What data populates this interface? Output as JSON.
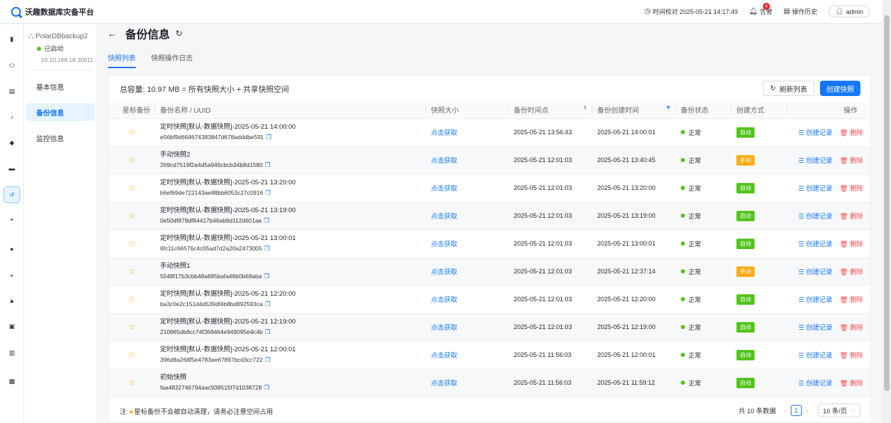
{
  "app": {
    "title": "沃趣数据库灾备平台"
  },
  "topbar": {
    "time_label": "时间校对 2025-05-21 14:17:49",
    "alerts_label": "告警",
    "alerts_count": "4",
    "history_label": "操作历史",
    "user": "admin"
  },
  "instance": {
    "name": "PolarDBbackup2",
    "status": "已启动",
    "address": "10.10.168.18:30011"
  },
  "subnav": [
    "基本信息",
    "备份信息",
    "监控信息"
  ],
  "page": {
    "title": "备份信息"
  },
  "tabs": [
    "快照列表",
    "快照操作日志"
  ],
  "summary": "总容量: 10.97 MB = 所有快照大小 + 共享快照空间",
  "buttons": {
    "refresh": "刷新列表",
    "create": "创建快照"
  },
  "columns": [
    "星标备份",
    "备份名称 / UUID",
    "快照大小",
    "备份时间点",
    "备份创建时间",
    "备份状态",
    "创建方式",
    "操作"
  ],
  "row_actions": {
    "size": "点击获取",
    "record": "创建记录",
    "delete": "删除"
  },
  "rows": [
    {
      "name": "定时快照[默认-数据快照]-2025-05-21 14:00:00",
      "uuid": "e56bf9d664674383847d678adddbe591",
      "time": "2025-05-21 13:56:43",
      "created": "2025-05-21 14:00:01",
      "status": "正常",
      "method": "自动"
    },
    {
      "name": "手动快照2",
      "uuid": "269cd7519f2a4d5a946cbcb34b8d1580",
      "time": "2025-05-21 12:01:03",
      "created": "2025-05-21 13:40:45",
      "status": "正常",
      "method": "手动"
    },
    {
      "name": "定时快照[默认-数据快照]-2025-05-21 13:20:00",
      "uuid": "b6ef69de722143ae88bb6053c27c0916",
      "time": "2025-05-21 12:01:03",
      "created": "2025-05-21 13:20:00",
      "status": "正常",
      "method": "自动"
    },
    {
      "name": "定时快照[默认-数据快照]-2025-05-21 13:19:00",
      "uuid": "0e50df878df84417b46ab9d112d601aa",
      "time": "2025-05-21 12:01:03",
      "created": "2025-05-21 13:19:00",
      "status": "正常",
      "method": "自动"
    },
    {
      "name": "定时快照[默认-数据快照]-2025-05-21 13:00:01",
      "uuid": "6fc11c66576c4c05ad7d2a20a2473005",
      "time": "2025-05-21 12:01:03",
      "created": "2025-05-21 13:00:01",
      "status": "正常",
      "method": "自动"
    },
    {
      "name": "手动快照1",
      "uuid": "5548f17b3cbb48a695bafa46b0b69aba",
      "time": "2025-05-21 12:01:03",
      "created": "2025-05-21 12:37:14",
      "status": "正常",
      "method": "手动"
    },
    {
      "name": "定时快照[默认-数据快照]-2025-05-21 12:20:00",
      "uuid": "ba3c0e2c151d4d539df4b8bd892593ca",
      "time": "2025-05-21 12:01:03",
      "created": "2025-05-21 12:20:00",
      "status": "正常",
      "method": "自动"
    },
    {
      "name": "定时快照[默认-数据快照]-2025-05-21 12:19:00",
      "uuid": "210965db8cc74f368464e949095e4c4b",
      "time": "2025-05-21 12:01:03",
      "created": "2025-05-21 12:19:00",
      "status": "正常",
      "method": "自动"
    },
    {
      "name": "定时快照[默认-数据快照]-2025-05-21 12:00:01",
      "uuid": "396d8a268f5e4783ae67897bcd3cc722",
      "time": "2025-05-21 11:56:03",
      "created": "2025-05-21 12:00:01",
      "status": "正常",
      "method": "自动"
    },
    {
      "name": "初始快照",
      "uuid": "faa4832746794aac938515f7d1038728",
      "time": "2025-05-21 11:56:03",
      "created": "2025-05-21 11:59:12",
      "status": "正常",
      "method": "自动"
    }
  ],
  "footer": {
    "note_prefix": "注:",
    "note_text": "星标备份不会被自动清理，请务必注意空间占用",
    "total": "共 10 条数据",
    "page": "1",
    "page_size": "10 条/页"
  },
  "colors": {
    "primary": "#1677ff",
    "success": "#52c41a",
    "warning": "#faad14",
    "danger": "#ff4d4f"
  }
}
